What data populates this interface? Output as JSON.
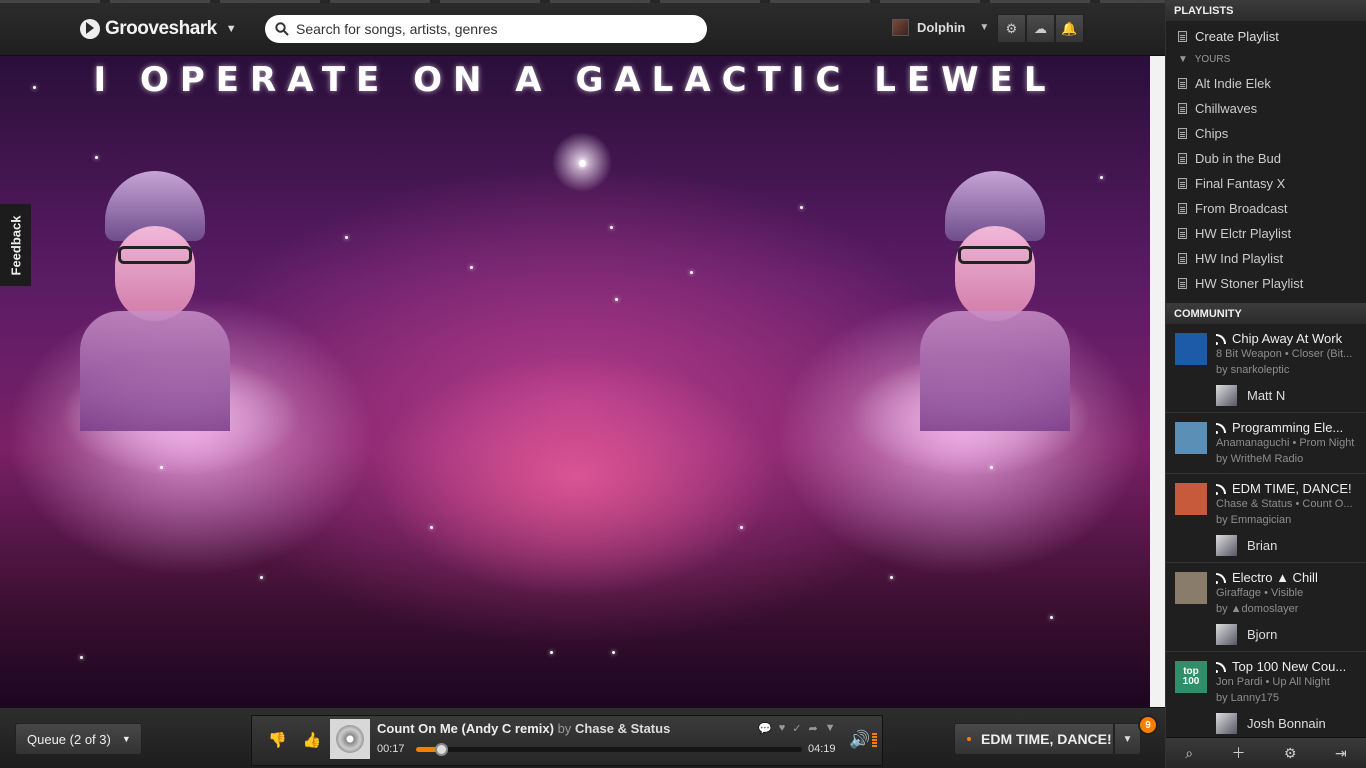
{
  "header": {
    "logo": "Grooveshark",
    "search_placeholder": "Search for songs, artists, genres",
    "user_name": "Dolphin",
    "icons": [
      "gear-icon",
      "upload-icon",
      "bell-icon"
    ]
  },
  "art": {
    "title": "I OPERATE ON A GALACTIC LEWEL"
  },
  "feedback": "Feedback",
  "sidebar": {
    "playlists_header": "PLAYLISTS",
    "create_playlist": "Create Playlist",
    "yours_label": "YOURS",
    "playlists": [
      "Alt Indie Elek",
      "Chillwaves",
      "Chips",
      "Dub in the Bud",
      "Final Fantasy X",
      "From Broadcast",
      "HW Elctr Playlist",
      "HW Ind Playlist",
      "HW Stoner Playlist"
    ],
    "community_header": "COMMUNITY",
    "community": [
      {
        "title": "Chip Away At Work",
        "track": "8 Bit Weapon • Closer (Bit...",
        "by": "by snarkoleptic",
        "listener": "Matt N",
        "thumb_color": "#1d5aa8"
      },
      {
        "title": "Programming Ele...",
        "track": "Anamanaguchi • Prom Night",
        "by": "by WritheM Radio",
        "listener": "",
        "thumb_color": "#5c8fb5"
      },
      {
        "title": "EDM TIME, DANCE!",
        "track": "Chase & Status • Count O...",
        "by": "by Emmagician",
        "listener": "Brian",
        "thumb_color": "#c65a3a"
      },
      {
        "title": "Electro ▲ Chill",
        "track": "Giraffage • Visible",
        "by": "by ▲domoslayer",
        "listener": "Bjorn",
        "thumb_color": "#8a7c6b"
      },
      {
        "title": "Top 100 New Cou...",
        "track": "Jon Pardi • Up All Night",
        "by": "by Lanny175",
        "listener": "Josh Bonnain",
        "thumb_color": "#2f8f6a",
        "thumb_text": "top 100"
      }
    ]
  },
  "player": {
    "queue_label": "Queue (2 of 3)",
    "song_title": "Count On Me (Andy C remix)",
    "by_word": "by",
    "artist": "Chase & Status",
    "elapsed": "00:17",
    "duration": "04:19",
    "progress": 0.066,
    "station": "EDM TIME, DANCE!",
    "badge_count": "9"
  }
}
